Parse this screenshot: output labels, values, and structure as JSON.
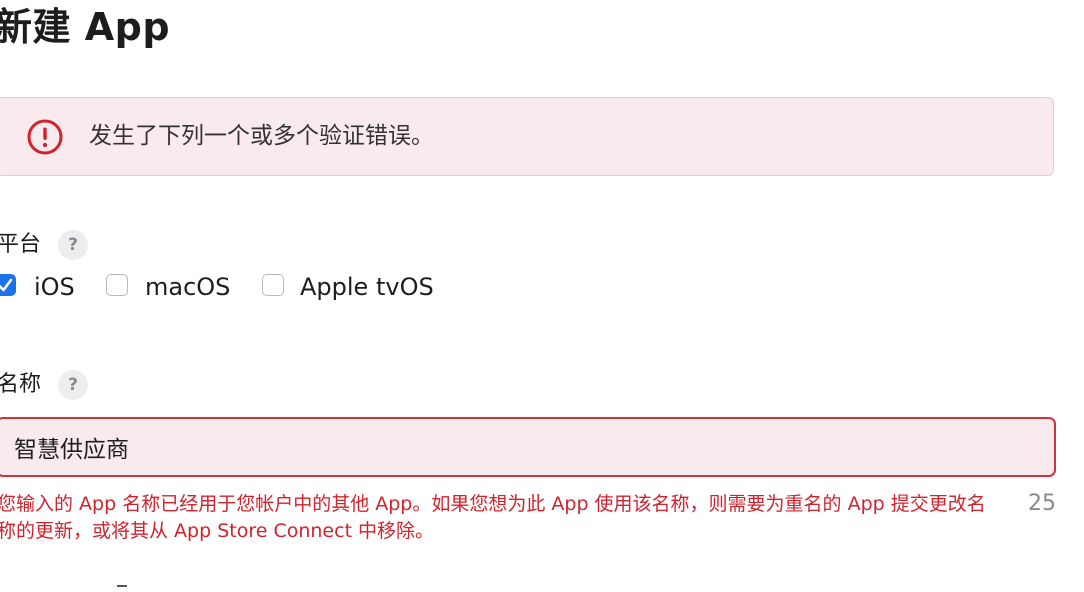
{
  "page": {
    "title": "新建 App"
  },
  "error_banner": {
    "message": "发生了下列一个或多个验证错误。",
    "icon": "exclamation-circle-icon",
    "accent_color": "#d0232d"
  },
  "platform": {
    "label": "平台",
    "help": "?",
    "options": [
      {
        "label": "iOS",
        "checked": true
      },
      {
        "label": "macOS",
        "checked": false
      },
      {
        "label": "Apple tvOS",
        "checked": false
      }
    ]
  },
  "name": {
    "label": "名称",
    "help": "?",
    "value": "智慧供应商",
    "error": "您输入的 App 名称已经用于您帐户中的其他 App。如果您想为此 App 使用该名称，则需要为重名的 App 提交更改名称的更新，或将其从 App Store Connect 中移除。",
    "char_count": "25"
  }
}
